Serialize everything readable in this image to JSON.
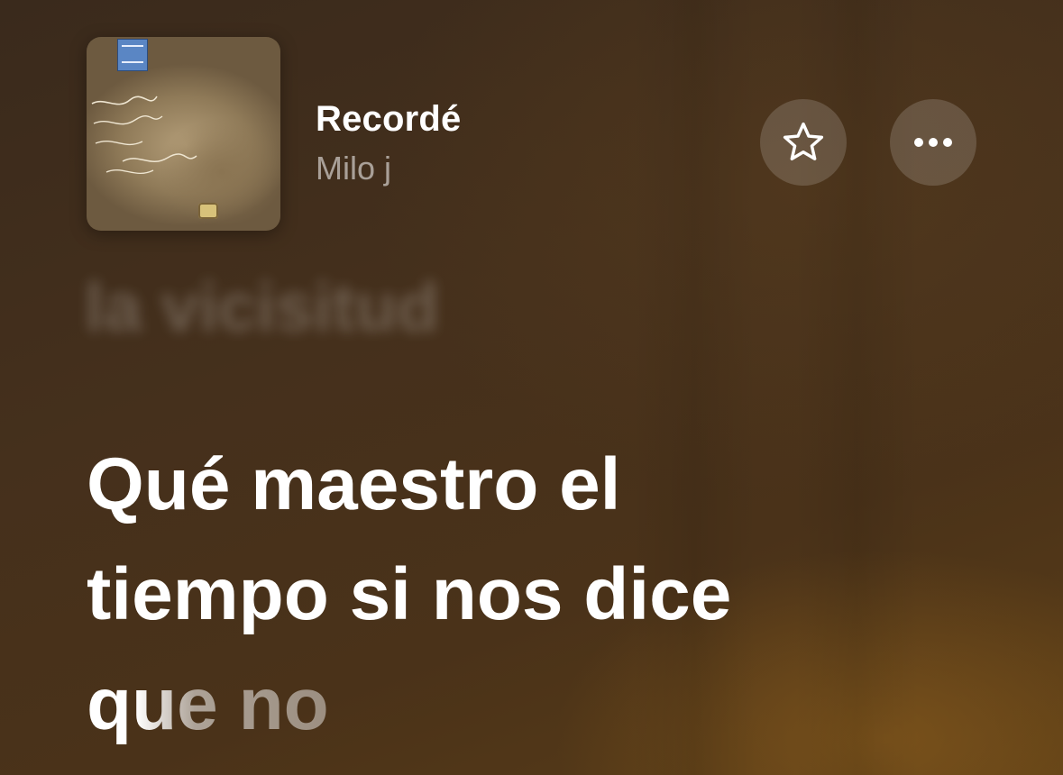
{
  "now_playing": {
    "title": "Recordé",
    "artist": "Milo j"
  },
  "controls": {
    "favorite_icon": "star-outline-icon",
    "more_icon": "ellipsis-icon"
  },
  "lyrics": {
    "previous_line": "la vicisitud",
    "current_lines": [
      "Qué maestro el",
      "tiempo si nos dice",
      "que no"
    ],
    "current_line_progress": 0.35
  },
  "colors": {
    "background_top": "#3a2a1c",
    "background_bottom": "#5a3d16",
    "lyric_active": "#ffffff",
    "secondary_text": "rgba(255,255,255,0.55)"
  }
}
